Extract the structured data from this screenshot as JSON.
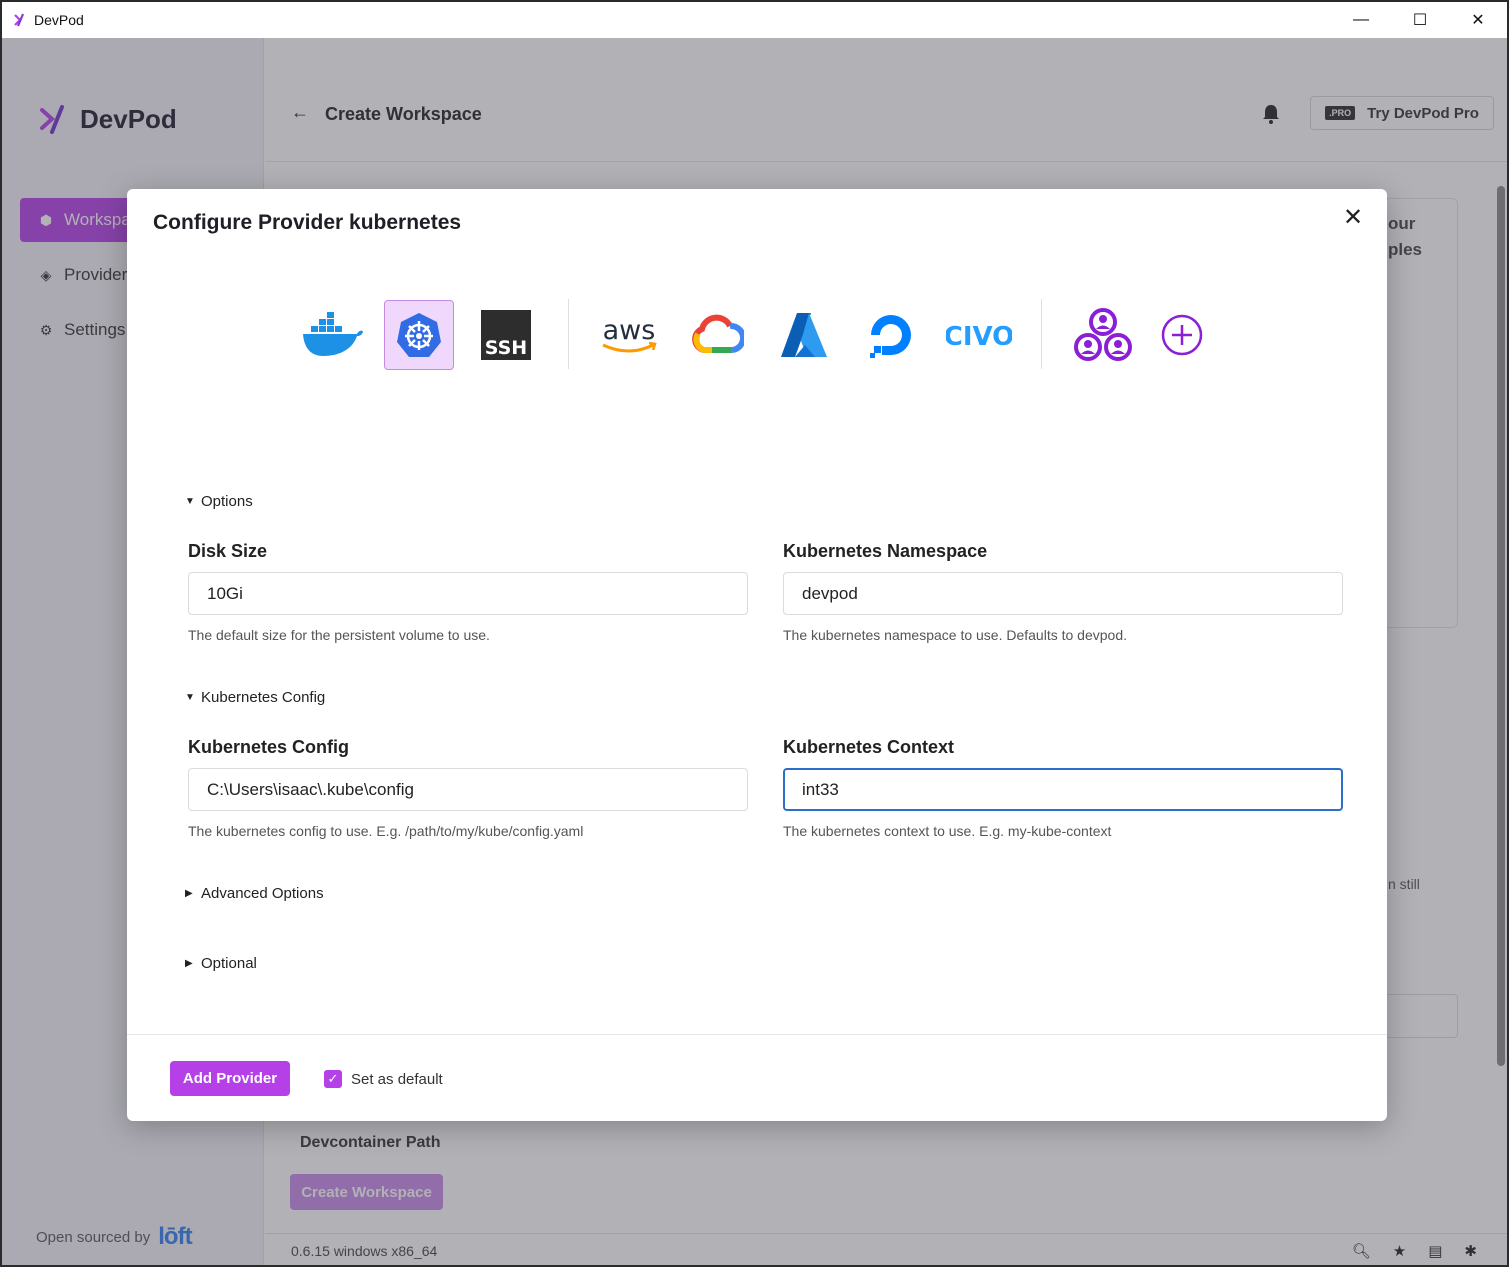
{
  "window": {
    "title": "DevPod",
    "controls": {
      "minimize": "—",
      "maximize": "☐",
      "close": "✕"
    }
  },
  "sidebar": {
    "brand": "DevPod",
    "items": [
      {
        "label": "Workspaces",
        "icon": "cube-icon",
        "active": true
      },
      {
        "label": "Providers",
        "icon": "layers-icon",
        "active": false
      },
      {
        "label": "Settings",
        "icon": "gear-icon",
        "active": false
      }
    ],
    "open_sourced_by": "Open sourced by",
    "loft": "lōft"
  },
  "header": {
    "back_icon": "←",
    "title": "Create Workspace",
    "pro_tag": ".PRO",
    "pro_label": "Try DevPod Pro"
  },
  "background": {
    "card_text_1": "our",
    "card_text_2": "ples",
    "still_text": "n still",
    "devcontainer_path": "Devcontainer Path",
    "create_workspace": "Create Workspace"
  },
  "statusbar": {
    "version": "0.6.15  windows  x86_64",
    "icons": [
      "zoom-icon",
      "star-icon",
      "document-icon",
      "bug-icon"
    ]
  },
  "modal": {
    "title": "Configure Provider kubernetes",
    "close_icon": "✕",
    "providers": [
      {
        "name": "docker",
        "selected": false
      },
      {
        "name": "kubernetes",
        "selected": true
      },
      {
        "name": "ssh",
        "label": "SSH",
        "selected": false
      },
      {
        "name": "aws",
        "label": "aws",
        "selected": false
      },
      {
        "name": "gcloud",
        "selected": false
      },
      {
        "name": "azure",
        "selected": false
      },
      {
        "name": "digitalocean",
        "selected": false
      },
      {
        "name": "civo",
        "label": "CIVO",
        "selected": false
      },
      {
        "name": "community",
        "selected": false
      },
      {
        "name": "custom",
        "selected": false
      }
    ],
    "sections": {
      "options": "Options",
      "kube_config": "Kubernetes Config",
      "advanced": "Advanced Options",
      "optional": "Optional"
    },
    "fields": {
      "disk_size": {
        "label": "Disk Size",
        "value": "10Gi",
        "help": "The default size for the persistent volume to use."
      },
      "namespace": {
        "label": "Kubernetes Namespace",
        "value": "devpod",
        "help": "The kubernetes namespace to use. Defaults to devpod."
      },
      "config": {
        "label": "Kubernetes Config",
        "value": "C:\\Users\\isaac\\.kube\\config",
        "help": "The kubernetes config to use. E.g. /path/to/my/kube/config.yaml"
      },
      "context": {
        "label": "Kubernetes Context",
        "value": "int33",
        "help": "The kubernetes context to use. E.g. my-kube-context"
      }
    },
    "footer": {
      "add_provider": "Add Provider",
      "set_default": "Set as default",
      "set_default_checked": true
    }
  },
  "colors": {
    "accent": "#b540e8",
    "focus": "#2a6fc9",
    "kubernetes": "#326ce5",
    "docker": "#1d91e6"
  }
}
